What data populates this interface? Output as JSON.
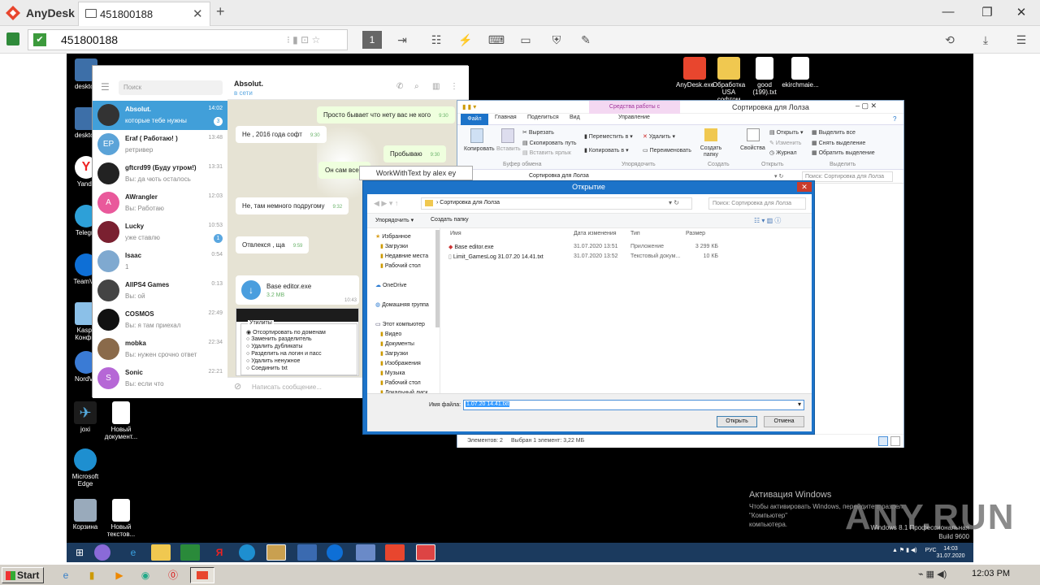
{
  "anydesk": {
    "title": "AnyDesk",
    "tab": "451800188",
    "address": "451800188",
    "session_num": "1"
  },
  "desktop": {
    "left_icons": [
      "desktop",
      "desktop",
      "Yande",
      "Telegra",
      "TeamVie",
      "Kaspe Конфиг",
      "NordVP"
    ],
    "bottom_icons": [
      {
        "label": "joxi"
      },
      {
        "label": "Новый документ..."
      },
      {
        "label": "Microsoft Edge"
      },
      {
        "label": "Корзина"
      },
      {
        "label": "Новый текстов..."
      }
    ],
    "top_icons": [
      {
        "label": "AnyDesk.exe"
      },
      {
        "label": "Обработка USA софтом"
      },
      {
        "label": "good (199).txt"
      },
      {
        "label": "ekirchmaie..."
      }
    ]
  },
  "telegram": {
    "search_placeholder": "Поиск",
    "chats": [
      {
        "name": "Absolut.",
        "preview": "которые тебе нужны",
        "time": "14:02",
        "badge": "3",
        "color": "#333",
        "initials": "",
        "active": true
      },
      {
        "name": "Eraf ( Работаю! )",
        "preview": "ретривер",
        "time": "13:48",
        "badge": "",
        "color": "#5ba3d8",
        "initials": "EP"
      },
      {
        "name": "gftcrd99 (Буду утром!)",
        "preview": "Вы: да чють осталось",
        "time": "13:31",
        "badge": "",
        "color": "#222",
        "initials": ""
      },
      {
        "name": "AWrangler",
        "preview": "Вы: Работаю",
        "time": "12:03",
        "badge": "",
        "color": "#e9599b",
        "initials": "A"
      },
      {
        "name": "Lucky",
        "preview": "уже ставлю",
        "time": "10:53",
        "badge": "1",
        "color": "#7a2030",
        "initials": ""
      },
      {
        "name": "Isaac",
        "preview": "1",
        "time": "0:54",
        "badge": "",
        "color": "#7fa9d0",
        "initials": ""
      },
      {
        "name": "AllPS4 Games",
        "preview": "Вы: ой",
        "time": "0:13",
        "badge": "",
        "color": "#444",
        "initials": ""
      },
      {
        "name": "COSMOS",
        "preview": "Вы: я там приехал",
        "time": "22:49",
        "badge": "",
        "color": "#111",
        "initials": ""
      },
      {
        "name": "mobka",
        "preview": "Вы: нужен срочно ответ",
        "time": "22:34",
        "badge": "",
        "color": "#8a6a4a",
        "initials": ""
      },
      {
        "name": "Sonic",
        "preview": "Вы: если что",
        "time": "22:21",
        "badge": "",
        "color": "#b667d6",
        "initials": "S"
      }
    ],
    "header_name": "Absolut.",
    "header_status": "в сети",
    "messages": [
      {
        "text": "Просто бывает что нету вас не кого",
        "time": "9:30",
        "out": true
      },
      {
        "text": "Не , 2016 года софт",
        "time": "9:30",
        "out": false
      },
      {
        "text": "Пробываю",
        "time": "9:30",
        "out": true
      },
      {
        "text": "Он сам все с",
        "time": "",
        "out": true
      },
      {
        "text": "Не, там немного подругому",
        "time": "9:32",
        "out": false
      },
      {
        "text": "Отвлекся , ща",
        "time": "9:59",
        "out": false
      }
    ],
    "file_name": "Base editor.exe",
    "file_size": "3.2 MB",
    "file_time": "10:43",
    "utils_title": "Утилиты",
    "utils": [
      "Отсортировать по доменам",
      "Заменить разделитель",
      "Удалить дубликаты",
      "Разделить на логин и пасс",
      "Удалить ненужное",
      "Соединить txt"
    ],
    "input_placeholder": "Написать сообщение..."
  },
  "wwt": {
    "title": "WorkWithText by alex ey"
  },
  "explorer": {
    "context_tab": "Средства работы с приложениями",
    "title": "Сортировка для Лолза",
    "tabs": [
      "Файл",
      "Главная",
      "Поделиться",
      "Вид",
      "Управление"
    ],
    "ribbon": {
      "copy": "Копировать",
      "paste": "Вставить",
      "cut": "Вырезать",
      "copy_path": "Скопировать путь",
      "paste_link": "Вставить ярлык",
      "move": "Переместить в",
      "copy_to": "Копировать в",
      "delete": "Удалить",
      "rename": "Переименовать",
      "new_folder": "Создать папку",
      "props": "Свойства",
      "open": "Открыть",
      "edit": "Изменить",
      "journal": "Журнал",
      "sel_all": "Выделить все",
      "sel_none": "Снять выделение",
      "sel_inv": "Обратить выделение",
      "g_clip": "Буфер обмена",
      "g_org": "Упорядочить",
      "g_new": "Создать",
      "g_open": "Открыть",
      "g_sel": "Выделить"
    },
    "path": "Сортировка для Лолза",
    "search": "Поиск: Сортировка для Лолза",
    "status_items": "Элементов: 2",
    "status_sel": "Выбран 1 элемент: 3,22 МБ"
  },
  "dialog": {
    "title": "Открытие",
    "path": "Сортировка для Лолза",
    "search": "Поиск: Сортировка для Лолза",
    "organize": "Упорядочить",
    "new_folder": "Создать папку",
    "tree": [
      "Избранное",
      "Загрузки",
      "Недавние места",
      "Рабочий стол",
      "OneDrive",
      "Домашняя группа",
      "Этот компьютер",
      "Видео",
      "Документы",
      "Загрузки",
      "Изображения",
      "Музыка",
      "Рабочий стол",
      "Локальный диск"
    ],
    "cols": [
      "Имя",
      "Дата изменения",
      "Тип",
      "Размер"
    ],
    "rows": [
      {
        "name": "Base editor.exe",
        "date": "31.07.2020 13:51",
        "type": "Приложение",
        "size": "3 299 КБ"
      },
      {
        "name": "Limit_GamesLog 31.07.20 14.41.txt",
        "date": "31.07.2020 13:52",
        "type": "Текстовый докум...",
        "size": "10 КБ"
      }
    ],
    "filename_label": "Имя файла:",
    "filename": "1.07.20 14.41.txt",
    "open_btn": "Открыть",
    "cancel_btn": "Отмена"
  },
  "watermark": {
    "line1": "Активация Windows",
    "line2": "Чтобы активировать Windows, перейдите в раздел \"Компьютер\"",
    "line3": "компьютера.",
    "brand": "ANY.RUN",
    "edition": "Windows 8.1 Профессиональная",
    "build": "Build 9600"
  },
  "remote_tray": {
    "lang": "РУС",
    "time": "14:03",
    "date": "31.07.2020"
  },
  "local": {
    "start": "Start",
    "clock": "12:03 PM"
  }
}
